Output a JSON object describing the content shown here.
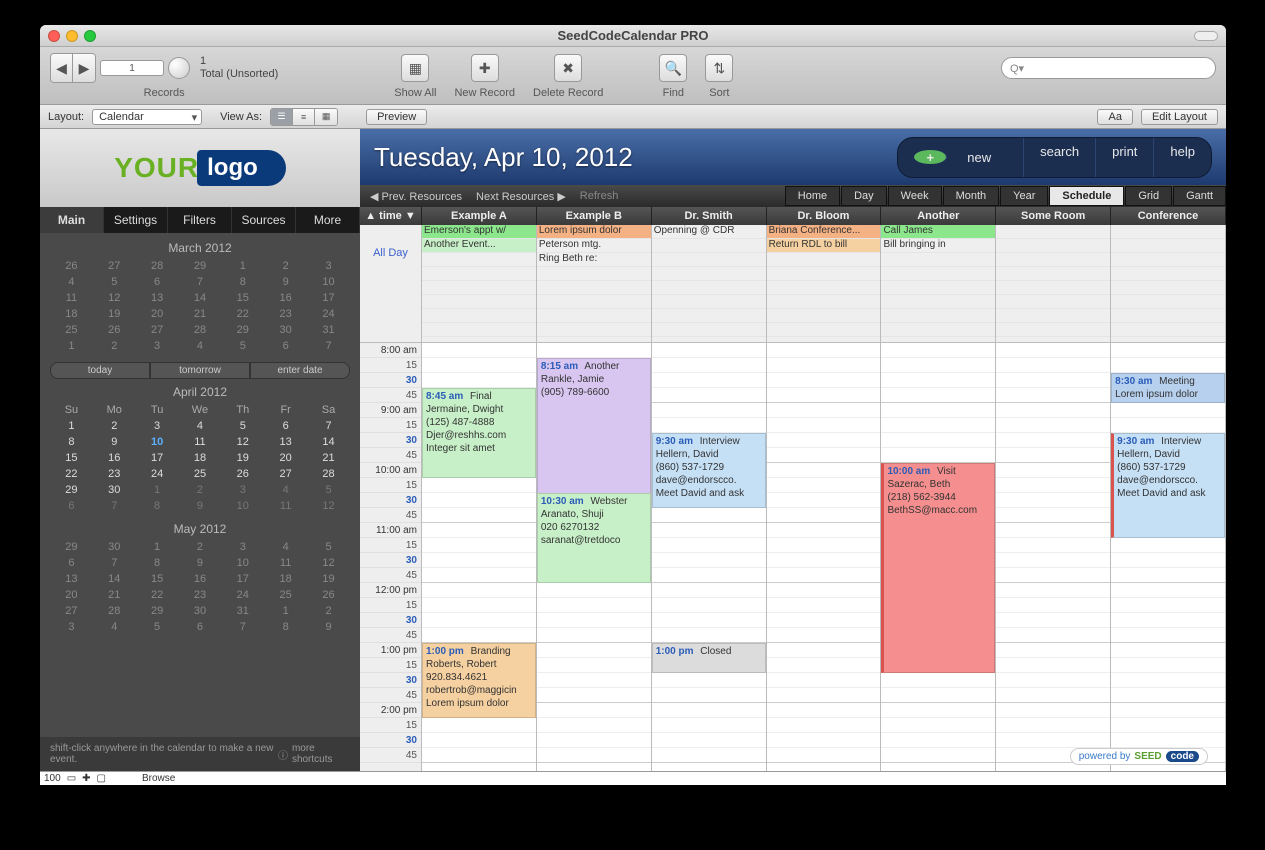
{
  "window": {
    "title": "SeedCodeCalendar PRO"
  },
  "toolbar": {
    "record_num": "1",
    "total_top": "1",
    "total_label": "Total (Unsorted)",
    "records_label": "Records",
    "show_all": "Show All",
    "new_record": "New Record",
    "delete_record": "Delete Record",
    "find": "Find",
    "sort": "Sort",
    "search_prefix": "Q▾"
  },
  "layoutbar": {
    "layout_label": "Layout:",
    "layout_value": "Calendar",
    "viewas_label": "View As:",
    "preview": "Preview",
    "aa": "Aa",
    "edit_layout": "Edit Layout"
  },
  "logo": {
    "your": "YOUR",
    "logo": "logo"
  },
  "sidetabs": [
    "Main",
    "Settings",
    "Filters",
    "Sources",
    "More"
  ],
  "quickpills": [
    "today",
    "tomorrow",
    "enter date"
  ],
  "minicals": [
    {
      "title": "March 2012",
      "current": false,
      "weeks": [
        [
          "26",
          "27",
          "28",
          "29",
          "1",
          "2",
          "3"
        ],
        [
          "4",
          "5",
          "6",
          "7",
          "8",
          "9",
          "10"
        ],
        [
          "11",
          "12",
          "13",
          "14",
          "15",
          "16",
          "17"
        ],
        [
          "18",
          "19",
          "20",
          "21",
          "22",
          "23",
          "24"
        ],
        [
          "25",
          "26",
          "27",
          "28",
          "29",
          "30",
          "31"
        ],
        [
          "1",
          "2",
          "3",
          "4",
          "5",
          "6",
          "7"
        ]
      ]
    },
    {
      "title": "April 2012",
      "current": true,
      "dow": [
        "Su",
        "Mo",
        "Tu",
        "We",
        "Th",
        "Fr",
        "Sa"
      ],
      "today": "10",
      "weeks": [
        [
          "1",
          "2",
          "3",
          "4",
          "5",
          "6",
          "7"
        ],
        [
          "8",
          "9",
          "10",
          "11",
          "12",
          "13",
          "14"
        ],
        [
          "15",
          "16",
          "17",
          "18",
          "19",
          "20",
          "21"
        ],
        [
          "22",
          "23",
          "24",
          "25",
          "26",
          "27",
          "28"
        ],
        [
          "29",
          "30",
          "1",
          "2",
          "3",
          "4",
          "5"
        ],
        [
          "6",
          "7",
          "8",
          "9",
          "10",
          "11",
          "12"
        ]
      ]
    },
    {
      "title": "May 2012",
      "current": false,
      "weeks": [
        [
          "29",
          "30",
          "1",
          "2",
          "3",
          "4",
          "5"
        ],
        [
          "6",
          "7",
          "8",
          "9",
          "10",
          "11",
          "12"
        ],
        [
          "13",
          "14",
          "15",
          "16",
          "17",
          "18",
          "19"
        ],
        [
          "20",
          "21",
          "22",
          "23",
          "24",
          "25",
          "26"
        ],
        [
          "27",
          "28",
          "29",
          "30",
          "31",
          "1",
          "2"
        ],
        [
          "3",
          "4",
          "5",
          "6",
          "7",
          "8",
          "9"
        ]
      ]
    }
  ],
  "hint": {
    "text": "shift-click anywhere in the calendar to make a new event.",
    "more": "more shortcuts"
  },
  "header": {
    "title": "Tuesday, Apr 10, 2012",
    "actions": {
      "new": "new",
      "search": "search",
      "print": "print",
      "help": "help"
    }
  },
  "navbar": {
    "prev": "◀ Prev. Resources",
    "next": "Next Resources ▶",
    "refresh": "Refresh",
    "tabs": [
      "Home",
      "Day",
      "Week",
      "Month",
      "Year",
      "Schedule",
      "Grid",
      "Gantt"
    ],
    "active": "Schedule"
  },
  "columns": [
    "▲ time ▼",
    "Example A",
    "Example B",
    "Dr. Smith",
    "Dr. Bloom",
    "Another",
    "Some Room",
    "Conference"
  ],
  "allday_label": "All Day",
  "allday": {
    "Example A": [
      {
        "t": "Emerson's appt w/",
        "c": "c-green"
      },
      {
        "t": "Another Event...",
        "c": "c-lgreen"
      }
    ],
    "Example B": [
      {
        "t": "Lorem ipsum dolor",
        "c": "c-salmon"
      },
      {
        "t": "Peterson mtg.",
        "c": ""
      },
      {
        "t": "Ring Beth re:",
        "c": ""
      }
    ],
    "Dr. Smith": [
      {
        "t": "Openning @ CDR",
        "c": ""
      }
    ],
    "Dr. Bloom": [
      {
        "t": "Briana Conference...",
        "c": "c-salmon"
      },
      {
        "t": "Return RDL to bill",
        "c": "c-orange"
      }
    ],
    "Another": [
      {
        "t": "Call James",
        "c": "c-green"
      },
      {
        "t": "Bill bringing in",
        "c": ""
      }
    ]
  },
  "hours": [
    "8:00 am",
    "9:00 am",
    "10:00 am",
    "11:00 am",
    "12:00 pm",
    "1:00 pm",
    "2:00 pm"
  ],
  "events": [
    {
      "col": 1,
      "start": 3,
      "len": 6,
      "c": "c-lgreen",
      "time": "8:45 am",
      "title": "Final",
      "lines": [
        "Jermaine, Dwight",
        "(125) 487-4888",
        "Djer@reshhs.com",
        "Integer sit amet"
      ]
    },
    {
      "col": 1,
      "start": 20,
      "len": 5,
      "c": "c-orange",
      "time": "1:00 pm",
      "title": "Branding",
      "lines": [
        "Roberts, Robert",
        "920.834.4621",
        "robertrob@maggicin",
        "Lorem ipsum dolor"
      ]
    },
    {
      "col": 2,
      "start": 1,
      "len": 15,
      "c": "c-purple",
      "time": "8:15 am",
      "title": "Another",
      "lines": [
        "Rankle, Jamie",
        "(905) 789-6600"
      ]
    },
    {
      "col": 2,
      "start": 10,
      "len": 6,
      "c": "c-lgreen",
      "time": "10:30 am",
      "title": "Webster",
      "lines": [
        "Aranato, Shuji",
        "020 6270132",
        "saranat@tretdoco"
      ]
    },
    {
      "col": 3,
      "start": 6,
      "len": 5,
      "c": "c-lblue",
      "time": "9:30 am",
      "title": "Interview",
      "lines": [
        "Hellern, David",
        "(860) 537-1729",
        "dave@endorscco.",
        "Meet David and ask"
      ]
    },
    {
      "col": 3,
      "start": 20,
      "len": 2,
      "c": "c-grey",
      "time": "1:00 pm",
      "title": "Closed",
      "lines": []
    },
    {
      "col": 5,
      "start": 8,
      "len": 14,
      "c": "c-red bar-red",
      "time": "10:00 am",
      "title": "Visit",
      "lines": [
        "Sazerac, Beth",
        "(218) 562-3944",
        "BethSS@macc.com"
      ]
    },
    {
      "col": 7,
      "start": 2,
      "len": 2,
      "c": "c-darkblue",
      "time": "8:30 am",
      "title": "Meeting",
      "lines": [
        "Lorem ipsum dolor"
      ]
    },
    {
      "col": 7,
      "start": 6,
      "len": 7,
      "c": "c-lblue bar-red",
      "time": "9:30 am",
      "title": "Interview",
      "lines": [
        "Hellern, David",
        "(860) 537-1729",
        "dave@endorscco.",
        "Meet David and ask"
      ]
    }
  ],
  "powered": {
    "label": "powered by",
    "seed": "SEED",
    "code": "code"
  },
  "statusbar": {
    "zoom": "100",
    "mode": "Browse"
  }
}
